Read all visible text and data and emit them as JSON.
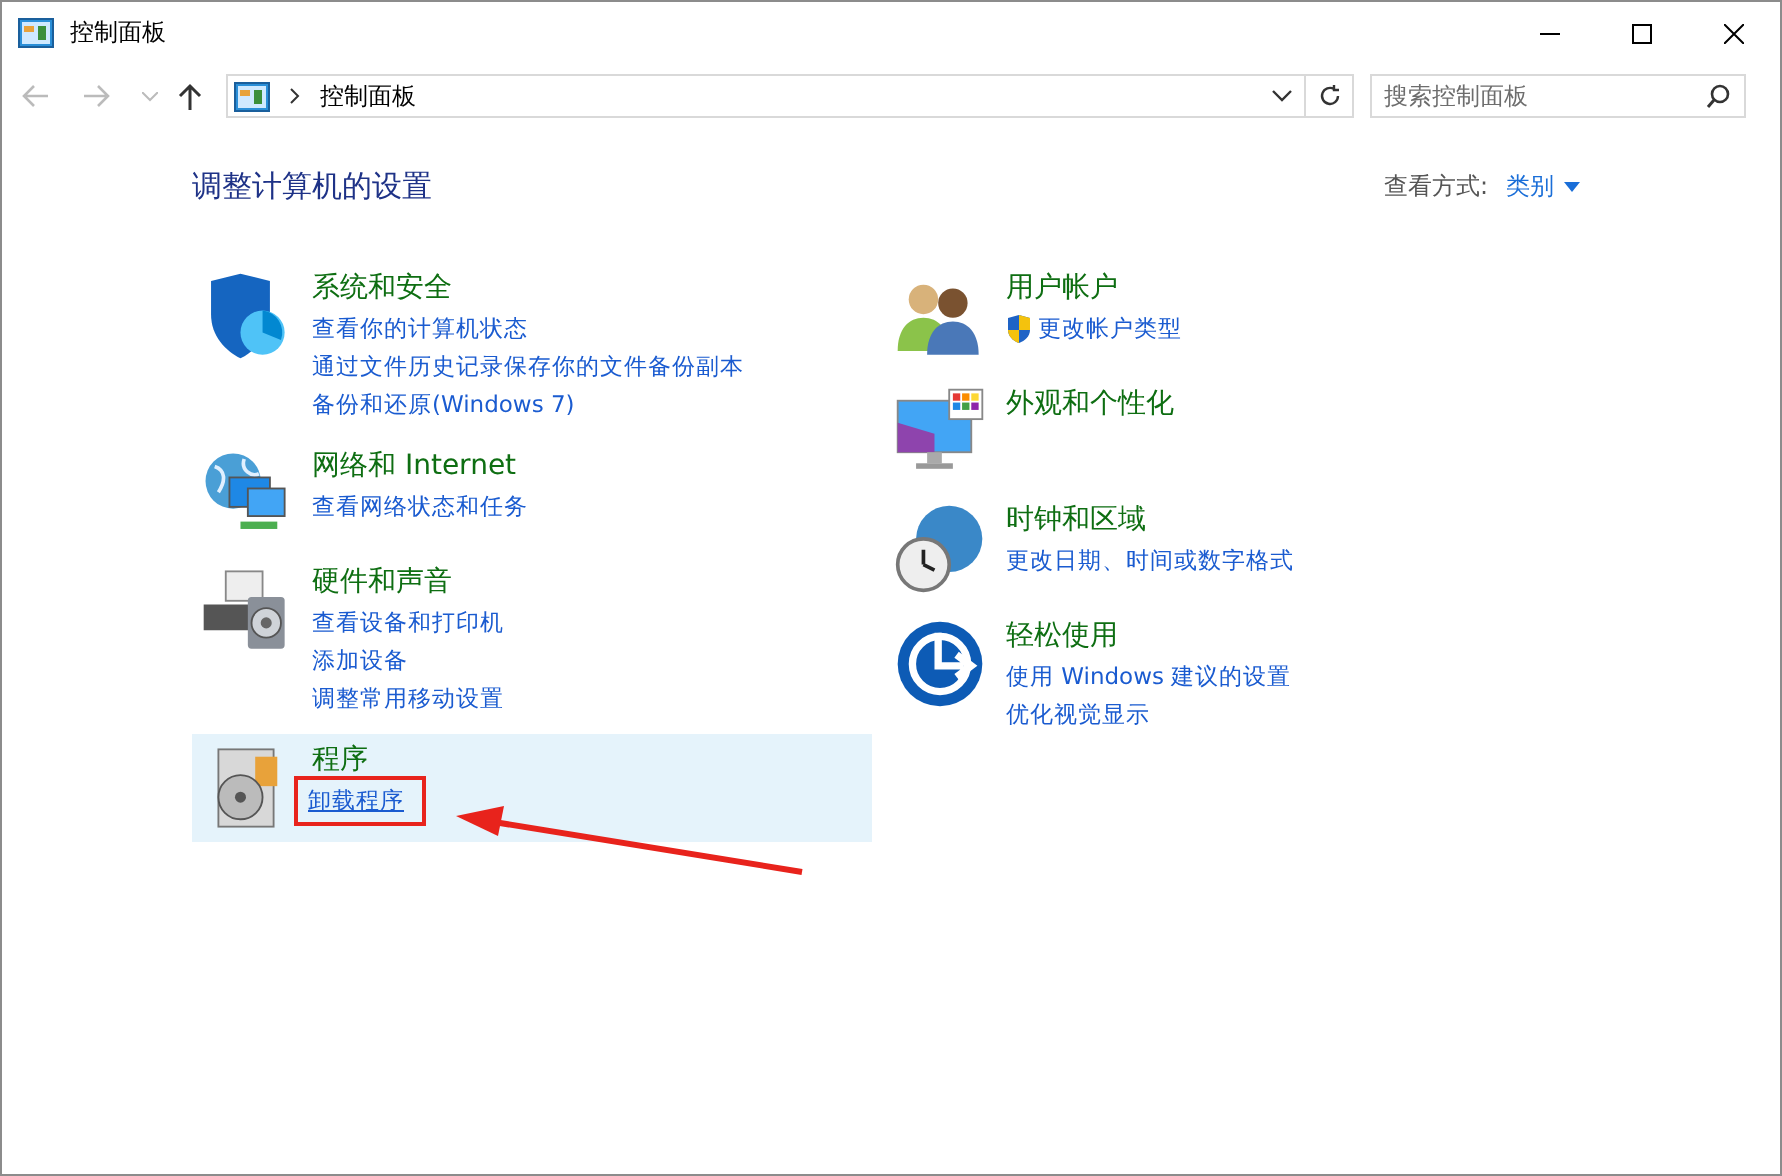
{
  "window": {
    "title": "控制面板"
  },
  "address_bar": {
    "path": "控制面板"
  },
  "search": {
    "placeholder": "搜索控制面板"
  },
  "heading": "调整计算机的设置",
  "view_by": {
    "label": "查看方式:",
    "value": "类别"
  },
  "columns": [
    [
      {
        "title": "系统和安全",
        "kind": "shield",
        "highlighted": false,
        "links": [
          {
            "text": "查看你的计算机状态",
            "shield": false,
            "underlined": false,
            "annotated": false
          },
          {
            "text": "通过文件历史记录保存你的文件备份副本",
            "shield": false,
            "underlined": false,
            "annotated": false
          },
          {
            "text": "备份和还原(Windows 7)",
            "shield": false,
            "underlined": false,
            "annotated": false
          }
        ]
      },
      {
        "title": "网络和 Internet",
        "kind": "network",
        "highlighted": false,
        "links": [
          {
            "text": "查看网络状态和任务",
            "shield": false,
            "underlined": false,
            "annotated": false
          }
        ]
      },
      {
        "title": "硬件和声音",
        "kind": "printer",
        "highlighted": false,
        "links": [
          {
            "text": "查看设备和打印机",
            "shield": false,
            "underlined": false,
            "annotated": false
          },
          {
            "text": "添加设备",
            "shield": false,
            "underlined": false,
            "annotated": false
          },
          {
            "text": "调整常用移动设置",
            "shield": false,
            "underlined": false,
            "annotated": false
          }
        ]
      },
      {
        "title": "程序",
        "kind": "programs",
        "highlighted": true,
        "links": [
          {
            "text": "卸载程序",
            "shield": false,
            "underlined": true,
            "annotated": true
          }
        ]
      }
    ],
    [
      {
        "title": "用户帐户",
        "kind": "users",
        "highlighted": false,
        "links": [
          {
            "text": "更改帐户类型",
            "shield": true,
            "underlined": false,
            "annotated": false
          }
        ]
      },
      {
        "title": "外观和个性化",
        "kind": "display",
        "highlighted": false
      },
      {
        "title": "时钟和区域",
        "kind": "clock",
        "highlighted": false,
        "links": [
          {
            "text": "更改日期、时间或数字格式",
            "shield": false,
            "underlined": false,
            "annotated": false
          }
        ]
      },
      {
        "title": "轻松使用",
        "kind": "access",
        "highlighted": false,
        "links": [
          {
            "text": "使用 Windows 建议的设置",
            "shield": false,
            "underlined": false,
            "annotated": false
          },
          {
            "text": "优化视觉显示",
            "shield": false,
            "underlined": false,
            "annotated": false
          }
        ]
      }
    ]
  ]
}
